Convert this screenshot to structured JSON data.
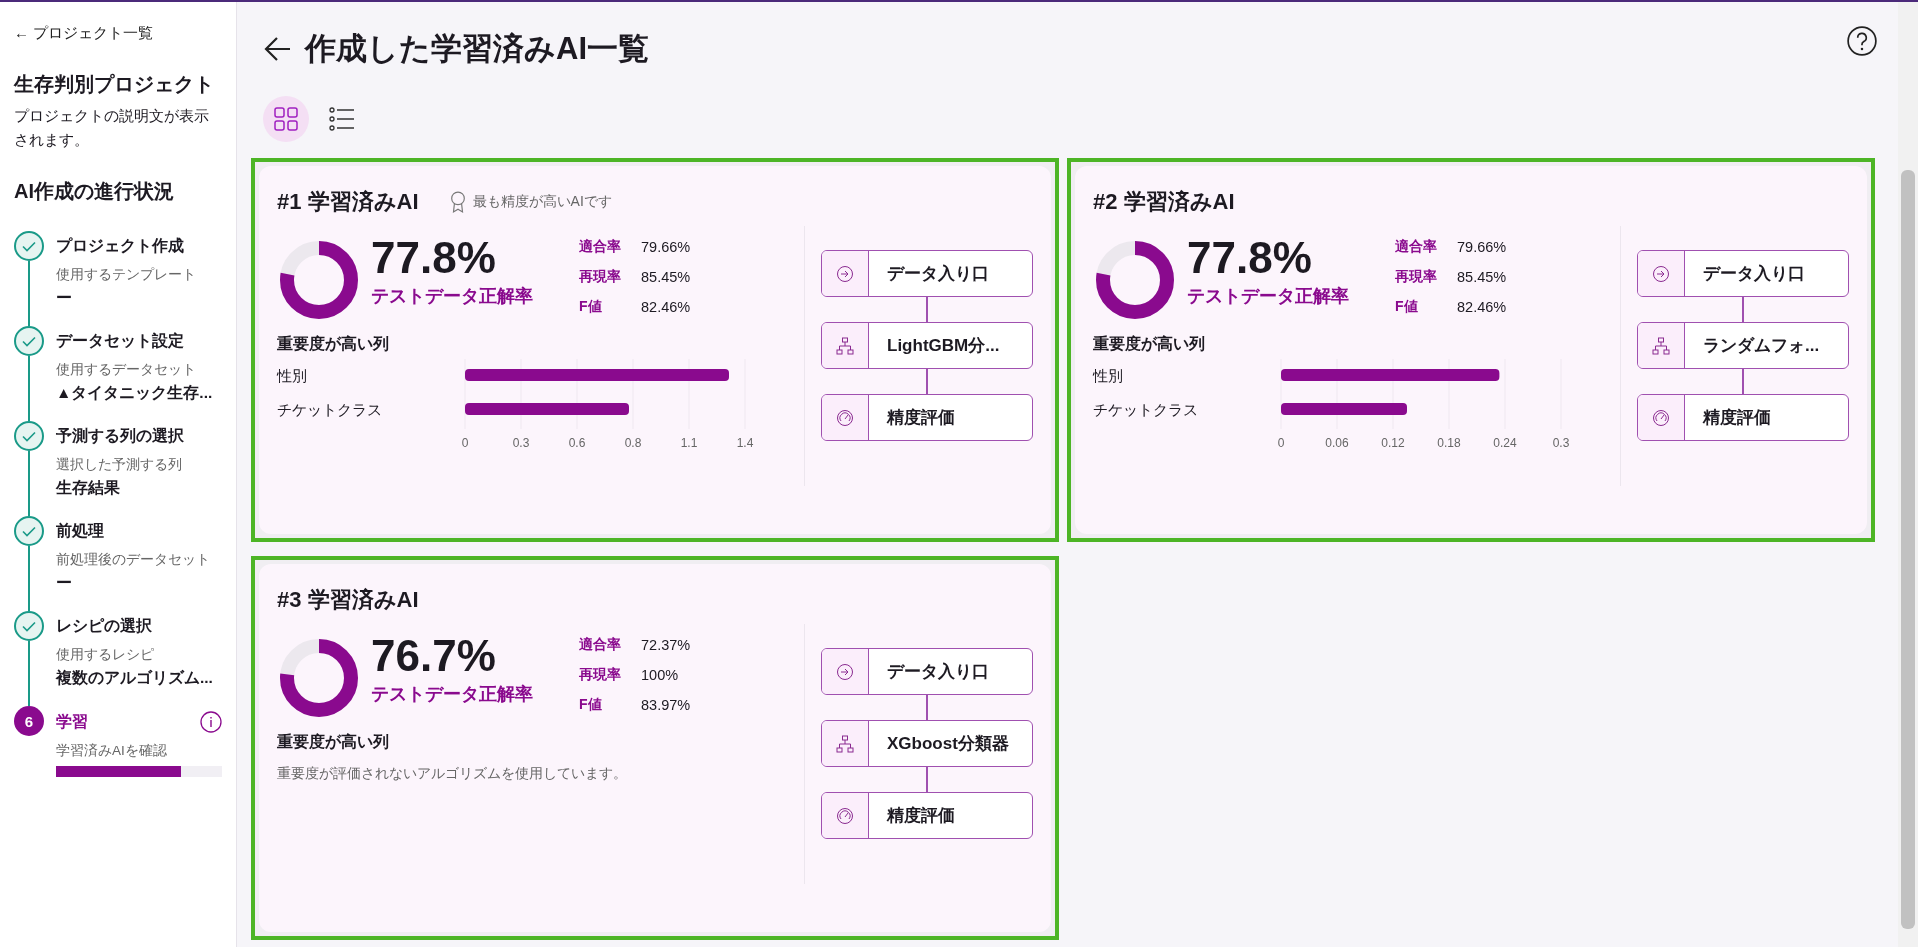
{
  "sidebar": {
    "back_link": "← プロジェクト一覧",
    "project_title": "生存判別プロジェクト",
    "project_description": "プロジェクトの説明文が表示されます。",
    "progress_title": "AI作成の進行状況",
    "steps": [
      {
        "kind": "done",
        "label": "プロジェクト作成",
        "sub": "使用するテンプレート",
        "value": "ー"
      },
      {
        "kind": "done",
        "label": "データセット設定",
        "sub": "使用するデータセット",
        "value": "▲タイタニック生存..."
      },
      {
        "kind": "done",
        "label": "予測する列の選択",
        "sub": "選択した予測する列",
        "value": "生存結果"
      },
      {
        "kind": "done",
        "label": "前処理",
        "sub": "前処理後のデータセット",
        "value": "ー"
      },
      {
        "kind": "done",
        "label": "レシピの選択",
        "sub": "使用するレシピ",
        "value": "複数のアルゴリズム..."
      },
      {
        "kind": "current",
        "number": "6",
        "label": "学習",
        "sub": "学習済みAIを確認",
        "level": 0.75
      }
    ]
  },
  "page": {
    "title": "作成した学習済みAI一覧",
    "view_toggle": [
      {
        "kind": "grid",
        "selected": true
      },
      {
        "kind": "list",
        "selected": false
      }
    ],
    "cards": [
      {
        "title": "#1 学習済みAI",
        "highlighted": true,
        "badge": "最も精度が高いAIです",
        "accuracy": "77.8%",
        "accuracy_label": "テストデータ正解率",
        "level": 0.778,
        "metrics": [
          {
            "label": "適合率",
            "value": "79.66%"
          },
          {
            "label": "再現率",
            "value": "85.45%"
          },
          {
            "label": "F値",
            "value": "82.46%"
          }
        ],
        "importance_title": "重要度が高い列",
        "chart_data": {
          "type": "bar",
          "orientation": "horizontal",
          "grid": true,
          "categories": [
            "性別",
            "チケットクラス"
          ],
          "values": [
            1.32,
            0.82
          ],
          "xlim": [
            0,
            1.4
          ],
          "xticks": [
            {
              "value": 0,
              "label": "0"
            },
            {
              "value": 0.28,
              "label": "0.3"
            },
            {
              "value": 0.56,
              "label": "0.6"
            },
            {
              "value": 0.84,
              "label": "0.8"
            },
            {
              "value": 1.12,
              "label": "1.1"
            },
            {
              "value": 1.4,
              "label": "1.4"
            }
          ]
        },
        "pipeline": [
          {
            "kind": "input",
            "label": "データ入り口"
          },
          {
            "kind": "model",
            "label": "LightGBM分..."
          },
          {
            "kind": "eval",
            "label": "精度評価"
          }
        ]
      },
      {
        "title": "#2 学習済みAI",
        "highlighted": true,
        "accuracy": "77.8%",
        "accuracy_label": "テストデータ正解率",
        "level": 0.778,
        "metrics": [
          {
            "label": "適合率",
            "value": "79.66%"
          },
          {
            "label": "再現率",
            "value": "85.45%"
          },
          {
            "label": "F値",
            "value": "82.46%"
          }
        ],
        "importance_title": "重要度が高い列",
        "chart_data": {
          "type": "bar",
          "orientation": "horizontal",
          "grid": true,
          "categories": [
            "性別",
            "チケットクラス"
          ],
          "values": [
            0.234,
            0.135
          ],
          "xlim": [
            0,
            0.3
          ],
          "xticks": [
            0,
            0.06,
            0.12,
            0.18,
            0.24,
            0.3
          ]
        },
        "pipeline": [
          {
            "kind": "input",
            "label": "データ入り口"
          },
          {
            "kind": "model",
            "label": "ランダムフォ..."
          },
          {
            "kind": "eval",
            "label": "精度評価"
          }
        ]
      },
      {
        "title": "#3 学習済みAI",
        "highlighted": true,
        "accuracy": "76.7%",
        "accuracy_label": "テストデータ正解率",
        "level": 0.767,
        "metrics": [
          {
            "label": "適合率",
            "value": "72.37%"
          },
          {
            "label": "再現率",
            "value": "100%"
          },
          {
            "label": "F値",
            "value": "83.97%"
          }
        ],
        "importance_title": "重要度が高い列",
        "importance_note": "重要度が評価されないアルゴリズムを使用しています。",
        "pipeline": [
          {
            "kind": "input",
            "label": "データ入り口"
          },
          {
            "kind": "model",
            "label": "XGboost分類器"
          },
          {
            "kind": "eval",
            "label": "精度評価"
          }
        ]
      }
    ]
  }
}
